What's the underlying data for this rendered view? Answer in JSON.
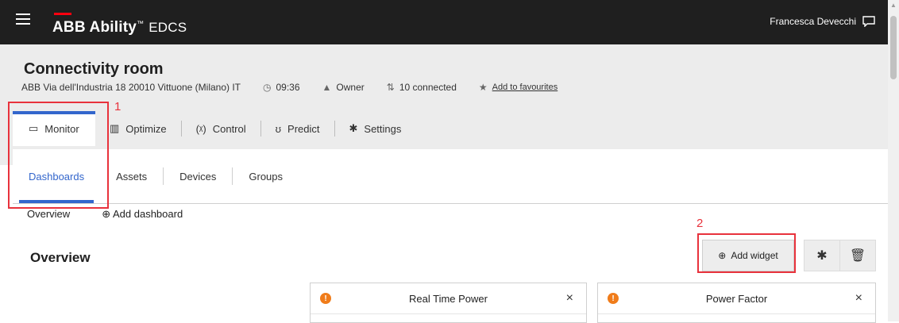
{
  "topbar": {
    "brand": "ABB Ability",
    "brand_tm": "™",
    "product": "EDCS",
    "user": "Francesca Devecchi"
  },
  "header": {
    "title": "Connectivity room",
    "address": "ABB Via dell'Industria 18 20010 Vittuone (Milano) IT",
    "time": "09:36",
    "role": "Owner",
    "connected": "10 connected",
    "favourite": "Add to favourites"
  },
  "tabs": [
    {
      "label": "Monitor"
    },
    {
      "label": "Optimize"
    },
    {
      "label": "Control"
    },
    {
      "label": "Predict"
    },
    {
      "label": "Settings"
    }
  ],
  "subnav": [
    {
      "label": "Dashboards"
    },
    {
      "label": "Assets"
    },
    {
      "label": "Devices"
    },
    {
      "label": "Groups"
    }
  ],
  "dashboards": {
    "current": "Overview",
    "add": "Add dashboard"
  },
  "overview": {
    "title": "Overview",
    "add_widget": "Add widget"
  },
  "widgets": [
    {
      "title": "Real Time Power",
      "close": "×"
    },
    {
      "title": "Power Factor",
      "close": "×"
    }
  ],
  "annotations": {
    "one": "1",
    "two": "2"
  },
  "colors": {
    "accent": "#3366cc",
    "topbar": "#1f1f1f",
    "annotation": "#e8323c",
    "warning": "#f07c1a"
  }
}
